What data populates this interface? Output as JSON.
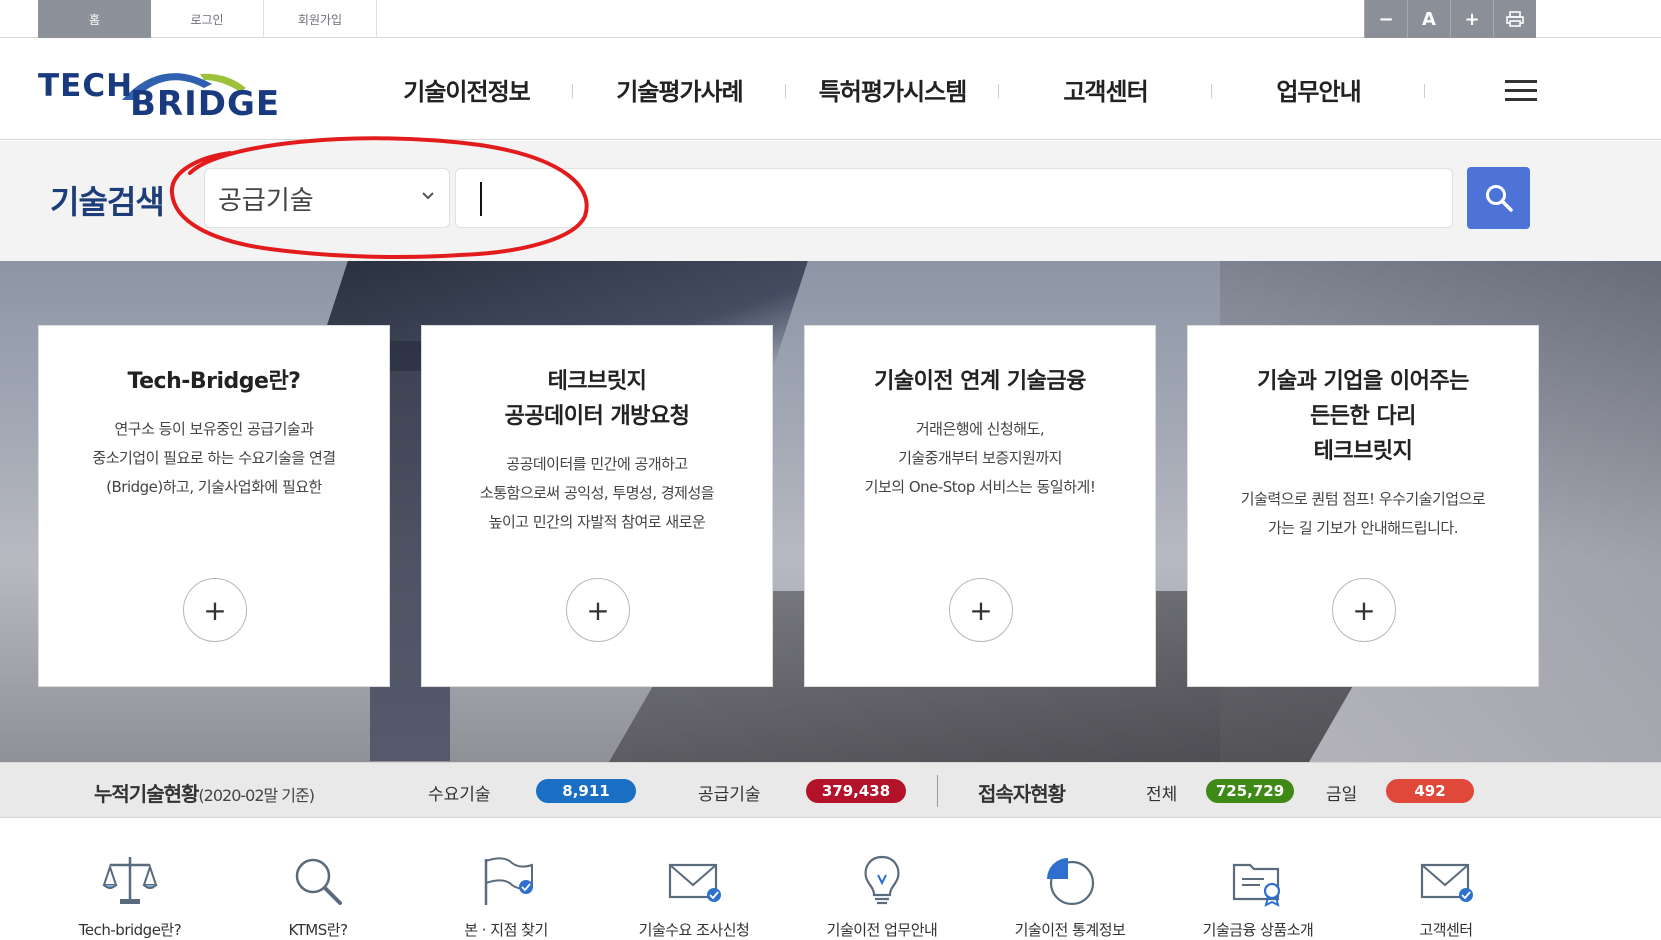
{
  "util": {
    "tabs": [
      "홈",
      "로그인",
      "회원가입"
    ],
    "buttons": [
      "−",
      "A",
      "+",
      "🖶"
    ]
  },
  "logo": {
    "line1": "TECH",
    "line2": "BRIDGE"
  },
  "gnb": [
    "기술이전정보",
    "기술평가사례",
    "특허평가시스템",
    "고객센터",
    "업무안내"
  ],
  "search": {
    "title": "기술검색",
    "select_value": "공급기술",
    "input_value": ""
  },
  "cards": [
    {
      "title": "Tech-Bridge란?",
      "desc": "연구소 등이 보유중인 공급기술과\n중소기업이 필요로 하는 수요기술을 연결\n(Bridge)하고, 기술사업화에 필요한",
      "more": "+"
    },
    {
      "title": "테크브릿지\n공공데이터 개방요청",
      "desc": "공공데이터를 민간에 공개하고\n소통함으로써 공익성, 투명성, 경제성을\n높이고 민간의 자발적 참여로 새로운",
      "more": "+"
    },
    {
      "title": "기술이전 연계 기술금융",
      "desc": "거래은행에 신청해도,\n기술중개부터 보증지원까지\n기보의 One-Stop 서비스는 동일하게!",
      "more": "+"
    },
    {
      "title": "기술과 기업을 이어주는\n든든한 다리\n테크브릿지",
      "desc": "기술력으로 퀀텀 점프! 우수기술기업으로\n가는 길 기보가 안내해드립니다.",
      "more": "+"
    }
  ],
  "stats": {
    "title": "누적기술현황",
    "subtitle": "(2020-02말 기준)",
    "demand_label": "수요기술",
    "demand_value": "8,911",
    "supply_label": "공급기술",
    "supply_value": "379,438",
    "visitor_title": "접속자현황",
    "total_label": "전체",
    "total_value": "725,729",
    "today_label": "금일",
    "today_value": "492",
    "colors": {
      "demand": "#1a6fc4",
      "supply": "#b3122a",
      "total": "#3f8a17",
      "today": "#e0483a"
    }
  },
  "quick_menu": [
    {
      "label": "Tech-bridge란?",
      "icon": "scales-icon"
    },
    {
      "label": "KTMS란?",
      "icon": "magnifier-icon"
    },
    {
      "label": "본 · 지점 찾기",
      "icon": "flag-icon"
    },
    {
      "label": "기술수요 조사신청",
      "icon": "mail-check-icon"
    },
    {
      "label": "기술이전 업무안내",
      "icon": "lightbulb-icon"
    },
    {
      "label": "기술이전 통계정보",
      "icon": "pie-chart-icon"
    },
    {
      "label": "기술금융 상품소개",
      "icon": "folder-award-icon"
    },
    {
      "label": "고객센터",
      "icon": "mail-icon"
    }
  ]
}
